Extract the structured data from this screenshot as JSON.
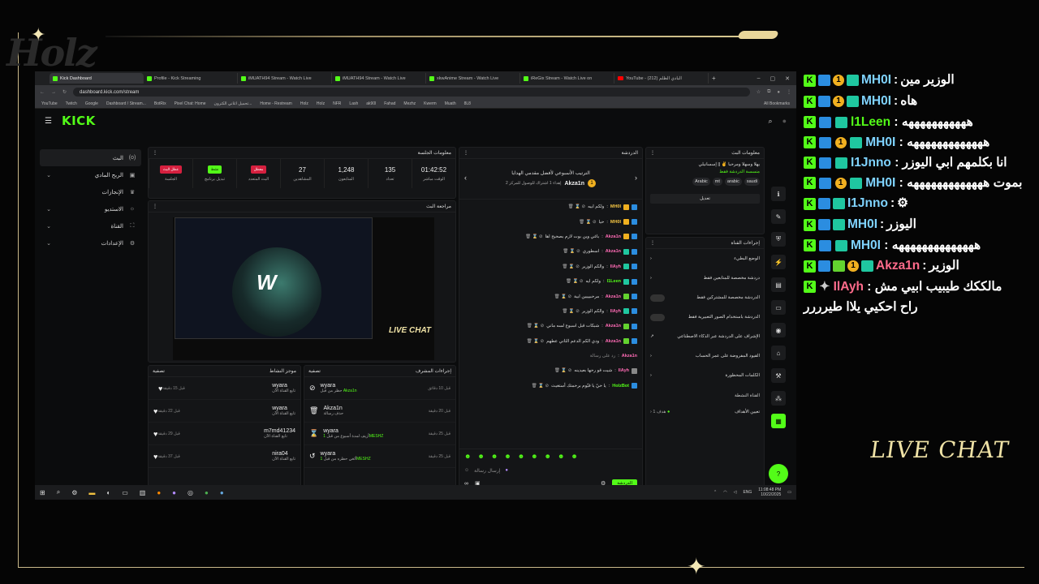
{
  "browser": {
    "tabs": [
      {
        "label": "Kick Dashboard",
        "active": true
      },
      {
        "label": "Profile - Kick Streaming"
      },
      {
        "label": "iMUATH94 Stream - Watch Live"
      },
      {
        "label": "iMUATH94 Stream - Watch Live"
      },
      {
        "label": "xkwAnime Stream - Watch Live"
      },
      {
        "label": "iReGix Stream - Watch Live on"
      },
      {
        "label": "YouTube - (212) البادي الظلم"
      }
    ],
    "url": "dashboard.kick.com/stream",
    "bookmarks": [
      "YouTube",
      "Twitch",
      "Google",
      "Dashboard / Stream...",
      "BotRix",
      "Pixel Chat: Home",
      "تحميل اغاني الكترون...",
      "Home - Restream",
      "Holz",
      "HoIz",
      "NFR",
      "Lash",
      "ak90l",
      "Fahad",
      "Mezhz",
      "Kwerm",
      "Muath",
      "8L8"
    ],
    "all_bookmarks": "All Bookmarks"
  },
  "kick": {
    "logo": "KICK",
    "sidebar": [
      {
        "label": "البث",
        "icon": "(o)"
      },
      {
        "label": "الربح المادي",
        "icon": "▣"
      },
      {
        "label": "الإنجازات",
        "icon": "♛"
      },
      {
        "label": "الاستديو",
        "icon": "☼"
      },
      {
        "label": "القناة",
        "icon": "⛶"
      },
      {
        "label": "الإعدادات",
        "icon": "⚙"
      }
    ],
    "session": {
      "title": "معلومات الجلسة",
      "stats": [
        {
          "value": "01:42:52",
          "label": "الوقت مباشر"
        },
        {
          "value": "135",
          "label": "تعداد"
        },
        {
          "value": "1,248",
          "label": "المتابعون"
        },
        {
          "value": "27",
          "label": "المشاهدين"
        },
        {
          "pill": "معطل",
          "pill_color": "#d6203f",
          "label": "البث المتعدد"
        },
        {
          "pill": "نشط",
          "pill_color": "#53fc18",
          "label": "تبديل برنامج"
        },
        {
          "pill": "عطل البث",
          "pill_color": "#d6203f",
          "label": "الجلسة"
        }
      ]
    },
    "preview": {
      "title": "مراجعة البث",
      "live_chat": "LIVE CHAT"
    },
    "activity": {
      "title": "موجز النشاط",
      "filter": "تصفية",
      "items": [
        {
          "name": "wyara",
          "sub": "تابع القناة الآن",
          "time": "قبل 15 دقيقة",
          "icon": "♥"
        },
        {
          "name": "wyara",
          "sub": "تابع القناة الآن",
          "time": "قبل 22 دقيقة",
          "icon": "♥"
        },
        {
          "name": "m7md41234",
          "sub": "تابع القناة الآن",
          "time": "قبل 29 دقيقة",
          "icon": "♥"
        },
        {
          "name": "nira04",
          "sub": "تابع القناة الآن",
          "time": "قبل 37 دقيقة",
          "icon": "♥"
        }
      ]
    },
    "moderation": {
      "title": "إجراءات المشرف",
      "filter": "تصفية",
      "items": [
        {
          "name": "wyara",
          "sub": "حظر من قبل",
          "who": "Akza1n",
          "time": "قبل 10 دقائق",
          "icon": "⊘"
        },
        {
          "name": "Akza1n",
          "sub": "حذف رسالة",
          "who": "",
          "time": "قبل 20 دقيقة",
          "icon": "🗑"
        },
        {
          "name": "wyara",
          "sub": "أزيف لمدة أسبوع من قبل",
          "who": "1MESHZ",
          "time": "قبل 25 دقيقة",
          "icon": "⌛"
        },
        {
          "name": "wyara",
          "sub": "ألغي حظره من قبل",
          "who": "1MESHZ",
          "time": "قبل 25 دقيقة",
          "icon": "↺"
        }
      ]
    },
    "chat": {
      "title": "الدردشة",
      "leaderboard": "الترتيب الأسبوعي لأفضل مقدمي الهدايا",
      "leader_name": "Akza1n",
      "leader_sub": "إهداء 1 اشتراك للوصول للمركز 2",
      "lines": [
        {
          "user": "MH0I",
          "text": "ولكم ابيه",
          "color": "gold"
        },
        {
          "user": "MH0I",
          "text": "حيا",
          "color": "gold"
        },
        {
          "user": "Akza1n",
          "text": "باغي وين بوت لازم بصحيح اها",
          "color": "pink"
        },
        {
          "user": "Akza1n",
          "text": "اسطوري",
          "color": "pink"
        },
        {
          "user": "IlAyh",
          "text": "والكم الوزير",
          "color": "pink"
        },
        {
          "user": "l1Leen",
          "text": "ولكم ايه",
          "color": ""
        },
        {
          "user": "Akza1n",
          "text": "مرحبيييين ابية",
          "color": "pink"
        },
        {
          "user": "IlAyh",
          "text": "والكم الوزير",
          "color": "pink"
        },
        {
          "user": "Akza1n",
          "text": "شبكات قبل اسبوع لسه ماني",
          "color": "pink"
        },
        {
          "user": "Akza1n",
          "text": "ودي الكم الدعم الثاني عطهم",
          "color": "pink"
        },
        {
          "user": "Akza1n",
          "text": "رد على رسالة",
          "color": "pink"
        },
        {
          "user": "IlAyh",
          "text": "شيت قو رحها بعيدينه",
          "color": "pink"
        },
        {
          "user": "HolzBot",
          "text": "يا حيّ يا قيّوم برحمتك أستغيث",
          "color": ""
        }
      ],
      "placeholder": "إرسال رسالة",
      "send": "الدردشة"
    },
    "stream_info": {
      "title": "معلومات البث",
      "stream_title": "يهلا وسهلا ومرحبا ✌️ || إسسانيلي",
      "category": "منسسة الدردشة فقط",
      "tags": [
        "Arabic",
        "mt",
        "arabic",
        "saudi"
      ],
      "edit": "تعديل"
    },
    "channel_actions": {
      "title": "إجراءات القناة",
      "items": [
        {
          "label": "الوضع البطيء",
          "type": "arrow"
        },
        {
          "label": "دردشة مخصصة للمتابعين فقط",
          "type": "arrow"
        },
        {
          "label": "الدردشة مخصصة للمشتركين فقط",
          "type": "toggle"
        },
        {
          "label": "الدردشة باستخدام الصور التعبيرية فقط",
          "type": "toggle"
        },
        {
          "label": "الإشراف على الدردشة عبر الذكاء الاصطناعي",
          "type": "link"
        },
        {
          "label": "القيود المفروضة على عمر الحساب",
          "type": "arrow"
        },
        {
          "label": "الكلمات المحظورة",
          "type": "arrow"
        }
      ],
      "active_section": "القناة النشطة",
      "goal_label": "تعيين الأهداف",
      "goal_value": "هدف 1"
    },
    "taskbar_time": "11:08:48 PM",
    "taskbar_date": "10/22/2025",
    "taskbar_lang": "ENG"
  },
  "overlay_chat": [
    {
      "badges": [
        "k",
        "b2",
        "b3",
        "b4"
      ],
      "user": "MH0I",
      "text": "الوزير مين",
      "color": "blue"
    },
    {
      "badges": [
        "k",
        "b2",
        "b3",
        "b4"
      ],
      "user": "MH0I",
      "text": "هاه",
      "color": "blue"
    },
    {
      "badges": [
        "k",
        "b2",
        "b4"
      ],
      "user": "l1Leen",
      "text": "هههههههههههه",
      "color": "green",
      "wrap": true
    },
    {
      "badges": [
        "k",
        "b2",
        "b3",
        "b4"
      ],
      "user": "MH0I",
      "text": "هههههههههههههه",
      "color": "blue",
      "wrap": true
    },
    {
      "badges": [
        "k",
        "b2",
        "b4"
      ],
      "user": "I1Jnno",
      "text": "انا بكلمهم ابي اليوزر",
      "color": "blue",
      "wrap": true
    },
    {
      "badges": [
        "k",
        "b2",
        "b3",
        "b4"
      ],
      "user": "MH0I",
      "text": "بموت هههههههههههههه",
      "color": "blue",
      "wrap": true
    },
    {
      "badges": [
        "k",
        "b2",
        "b4"
      ],
      "user": "I1Jnno",
      "text": "⚙",
      "color": "blue"
    },
    {
      "badges": [
        "k",
        "b2",
        "b4"
      ],
      "user": "MH0I",
      "text": "اليوزر",
      "color": "blue"
    },
    {
      "badges": [
        "k",
        "b2",
        "b4"
      ],
      "user": "MH0I",
      "text": "ههههههههههههههه",
      "color": "blue",
      "wrap": true
    },
    {
      "badges": [
        "k",
        "b2",
        "b5",
        "b3",
        "b4"
      ],
      "user": "Akza1n",
      "text": "الوزير",
      "color": "pink"
    },
    {
      "badges": [
        "k",
        "sw"
      ],
      "user": "IlAyh",
      "text": "مالككك طيبيب ابيي مش راح احكيي يلاا طيرررر",
      "color": "pink",
      "wrap": true
    }
  ],
  "overlay_title": "LIVE CHAT",
  "logo_text": "Holz"
}
